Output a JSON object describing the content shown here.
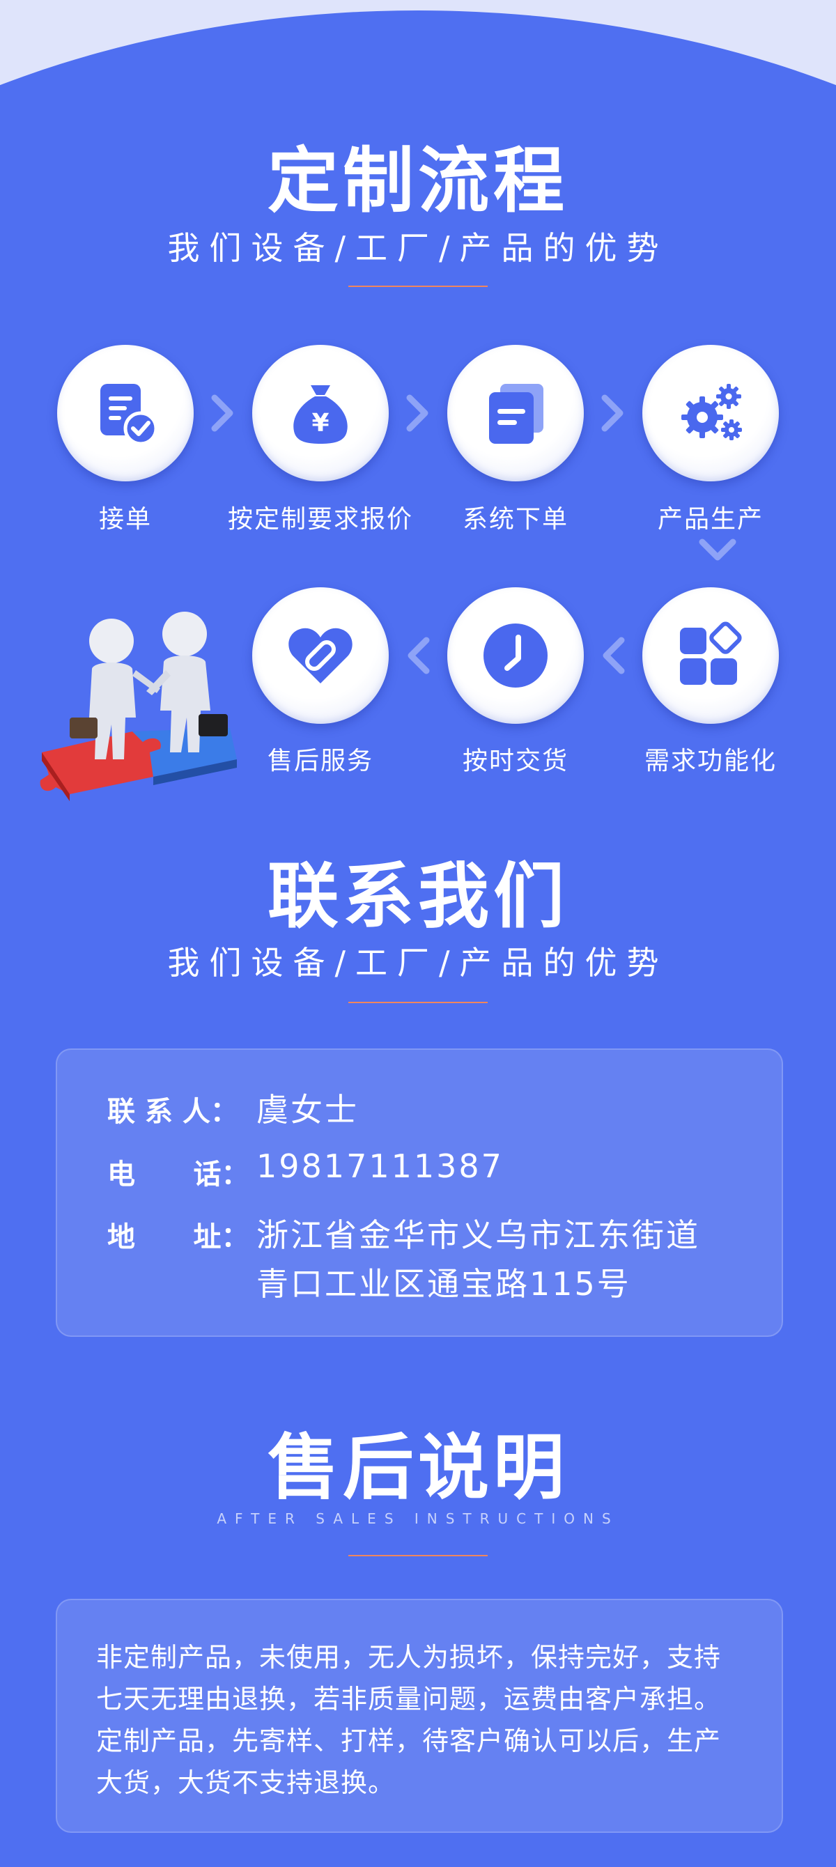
{
  "process": {
    "title": "定制流程",
    "subtitle": "我们设备/工厂/产品的优势",
    "steps": [
      {
        "label": "接单",
        "icon": "document-check-icon"
      },
      {
        "label": "按定制要求报价",
        "icon": "money-bag-icon"
      },
      {
        "label": "系统下单",
        "icon": "documents-icon"
      },
      {
        "label": "产品生产",
        "icon": "gears-icon"
      },
      {
        "label": "需求功能化",
        "icon": "app-blocks-icon"
      },
      {
        "label": "按时交货",
        "icon": "clock-icon"
      },
      {
        "label": "售后服务",
        "icon": "heart-icon"
      }
    ]
  },
  "contact": {
    "title": "联系我们",
    "subtitle": "我们设备/工厂/产品的优势",
    "person_label": "联 系 人：",
    "person_value": "虞女士",
    "phone_label": "电      话：",
    "phone_value": "19817111387",
    "address_label": "地      址：",
    "address_line1": "浙江省金华市义乌市江东街道",
    "address_line2": "青口工业区通宝路115号"
  },
  "after_sales": {
    "title": "售后说明",
    "subtitle_en": "AFTER SALES INSTRUCTIONS",
    "line1": "非定制产品，未使用，无人为损坏，保持完好，支持",
    "line2": "七天无理由退换，若非质量问题，运费由客户承担。",
    "line3": "定制产品，先寄样、打样，待客户确认可以后，生产",
    "line4": "大货，大货不支持退换。"
  },
  "colors": {
    "background": "#4f6ff1",
    "icon_blue": "#4a68ee",
    "divider": "#f0865d",
    "top_light": "#dfe4fb"
  }
}
